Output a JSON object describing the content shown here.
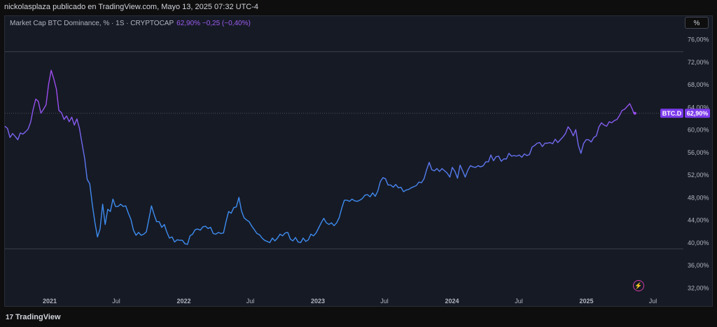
{
  "header": {
    "publisher_line": "nickolasplaza publicado en TradingView.com, Mayo 13, 2025 07:32 UTC-4"
  },
  "legend": {
    "symbol_text": "Market Cap BTC Dominance, % · 1S · CRYPTOCAP",
    "value_text": "62,90%  −0,25 (−0,40%)"
  },
  "controls": {
    "percent_button": "%",
    "bolt_icon": "⚡"
  },
  "footer": {
    "brand": "TradingView",
    "logo_icon": "17"
  },
  "colors": {
    "line_start": "#3d8cf0",
    "line_end": "#9d4cf0",
    "tag_bg": "#7c3aed",
    "accent": "#9d5cf0"
  },
  "chart_data": {
    "type": "line",
    "title": "Market Cap BTC Dominance, % · 1S · CRYPTOCAP",
    "ylim": [
      30,
      78
    ],
    "xlim": [
      "2020-09-01",
      "2025-09-20"
    ],
    "y_ticks": [
      32,
      36,
      40,
      44,
      48,
      52,
      56,
      60,
      64,
      68,
      72,
      76
    ],
    "y_tick_labels": [
      "32,00%",
      "36,00%",
      "40,00%",
      "44,00%",
      "48,00%",
      "52,00%",
      "56,00%",
      "60,00%",
      "64,00%",
      "68,00%",
      "72,00%",
      "76,00%"
    ],
    "x_ticks": [
      {
        "date": "2021-01-01",
        "label": "2021"
      },
      {
        "date": "2021-07-01",
        "label": "Jul"
      },
      {
        "date": "2022-01-01",
        "label": "2022"
      },
      {
        "date": "2022-07-01",
        "label": "Jul"
      },
      {
        "date": "2023-01-01",
        "label": "2023"
      },
      {
        "date": "2023-07-01",
        "label": "Jul"
      },
      {
        "date": "2024-01-01",
        "label": "2024"
      },
      {
        "date": "2024-07-01",
        "label": "Jul"
      },
      {
        "date": "2025-01-01",
        "label": "2025"
      },
      {
        "date": "2025-07-01",
        "label": "Jul"
      }
    ],
    "hlines": [
      73.8,
      38.9
    ],
    "current_value": 62.9,
    "current_tag": {
      "symbol": "BTC.D",
      "value": "62,90%"
    },
    "series": [
      {
        "points": [
          [
            "2020-09-01",
            60.6
          ],
          [
            "2020-09-08",
            60.2
          ],
          [
            "2020-09-15",
            58.6
          ],
          [
            "2020-09-22",
            59.3
          ],
          [
            "2020-09-29",
            58.8
          ],
          [
            "2020-10-06",
            58.2
          ],
          [
            "2020-10-13",
            59.4
          ],
          [
            "2020-10-20",
            59.2
          ],
          [
            "2020-10-27",
            59.6
          ],
          [
            "2020-11-03",
            60.1
          ],
          [
            "2020-11-10",
            61.3
          ],
          [
            "2020-11-17",
            63.6
          ],
          [
            "2020-11-24",
            65.4
          ],
          [
            "2020-12-01",
            65.0
          ],
          [
            "2020-12-08",
            62.9
          ],
          [
            "2020-12-15",
            63.6
          ],
          [
            "2020-12-22",
            64.4
          ],
          [
            "2020-12-29",
            68.0
          ],
          [
            "2021-01-05",
            70.5
          ],
          [
            "2021-01-12",
            69.0
          ],
          [
            "2021-01-19",
            67.2
          ],
          [
            "2021-01-26",
            63.4
          ],
          [
            "2021-02-02",
            63.0
          ],
          [
            "2021-02-09",
            61.8
          ],
          [
            "2021-02-16",
            62.4
          ],
          [
            "2021-02-23",
            61.4
          ],
          [
            "2021-03-02",
            62.2
          ],
          [
            "2021-03-09",
            60.8
          ],
          [
            "2021-03-16",
            61.9
          ],
          [
            "2021-03-23",
            60.2
          ],
          [
            "2021-03-30",
            57.5
          ],
          [
            "2021-04-06",
            54.9
          ],
          [
            "2021-04-13",
            51.2
          ],
          [
            "2021-04-20",
            50.4
          ],
          [
            "2021-04-27",
            46.7
          ],
          [
            "2021-05-04",
            43.6
          ],
          [
            "2021-05-11",
            41.0
          ],
          [
            "2021-05-18",
            42.4
          ],
          [
            "2021-05-25",
            46.8
          ],
          [
            "2021-06-01",
            43.2
          ],
          [
            "2021-06-08",
            45.9
          ],
          [
            "2021-06-15",
            45.5
          ],
          [
            "2021-06-22",
            47.7
          ],
          [
            "2021-06-29",
            46.4
          ],
          [
            "2021-07-06",
            46.4
          ],
          [
            "2021-07-13",
            46.8
          ],
          [
            "2021-07-20",
            46.4
          ],
          [
            "2021-07-27",
            46.5
          ],
          [
            "2021-08-03",
            45.2
          ],
          [
            "2021-08-10",
            44.1
          ],
          [
            "2021-08-17",
            42.2
          ],
          [
            "2021-08-24",
            41.3
          ],
          [
            "2021-08-31",
            41.8
          ],
          [
            "2021-09-07",
            41.3
          ],
          [
            "2021-09-14",
            41.5
          ],
          [
            "2021-09-21",
            41.9
          ],
          [
            "2021-09-28",
            44.2
          ],
          [
            "2021-10-05",
            46.5
          ],
          [
            "2021-10-12",
            45.0
          ],
          [
            "2021-10-19",
            43.7
          ],
          [
            "2021-10-26",
            43.7
          ],
          [
            "2021-11-02",
            42.7
          ],
          [
            "2021-11-09",
            43.2
          ],
          [
            "2021-11-16",
            41.8
          ],
          [
            "2021-11-23",
            40.8
          ],
          [
            "2021-11-30",
            41.0
          ],
          [
            "2021-12-07",
            40.1
          ],
          [
            "2021-12-14",
            40.5
          ],
          [
            "2021-12-21",
            40.4
          ],
          [
            "2021-12-28",
            40.4
          ],
          [
            "2022-01-04",
            39.8
          ],
          [
            "2022-01-11",
            39.7
          ],
          [
            "2022-01-18",
            41.2
          ],
          [
            "2022-01-25",
            41.5
          ],
          [
            "2022-02-01",
            42.3
          ],
          [
            "2022-02-08",
            42.4
          ],
          [
            "2022-02-15",
            42.2
          ],
          [
            "2022-02-22",
            42.8
          ],
          [
            "2022-03-01",
            42.9
          ],
          [
            "2022-03-08",
            42.5
          ],
          [
            "2022-03-15",
            42.7
          ],
          [
            "2022-03-22",
            41.6
          ],
          [
            "2022-03-29",
            41.5
          ],
          [
            "2022-04-05",
            41.8
          ],
          [
            "2022-04-12",
            41.6
          ],
          [
            "2022-04-19",
            41.7
          ],
          [
            "2022-04-26",
            43.7
          ],
          [
            "2022-05-03",
            45.5
          ],
          [
            "2022-05-10",
            45.2
          ],
          [
            "2022-05-17",
            46.2
          ],
          [
            "2022-05-24",
            46.3
          ],
          [
            "2022-05-31",
            48.0
          ],
          [
            "2022-06-07",
            45.6
          ],
          [
            "2022-06-14",
            44.4
          ],
          [
            "2022-06-21",
            44.0
          ],
          [
            "2022-06-28",
            43.7
          ],
          [
            "2022-07-05",
            42.9
          ],
          [
            "2022-07-12",
            42.3
          ],
          [
            "2022-07-19",
            41.6
          ],
          [
            "2022-07-26",
            41.4
          ],
          [
            "2022-08-02",
            40.8
          ],
          [
            "2022-08-09",
            40.4
          ],
          [
            "2022-08-16",
            40.2
          ],
          [
            "2022-08-23",
            40.0
          ],
          [
            "2022-08-30",
            40.8
          ],
          [
            "2022-09-06",
            40.3
          ],
          [
            "2022-09-13",
            40.8
          ],
          [
            "2022-09-20",
            41.5
          ],
          [
            "2022-09-27",
            41.2
          ],
          [
            "2022-10-04",
            41.7
          ],
          [
            "2022-10-11",
            41.8
          ],
          [
            "2022-10-18",
            40.6
          ],
          [
            "2022-10-25",
            40.3
          ],
          [
            "2022-11-01",
            40.9
          ],
          [
            "2022-11-08",
            40.1
          ],
          [
            "2022-11-15",
            40.0
          ],
          [
            "2022-11-22",
            40.8
          ],
          [
            "2022-11-29",
            40.2
          ],
          [
            "2022-12-06",
            40.5
          ],
          [
            "2022-12-13",
            41.5
          ],
          [
            "2022-12-20",
            41.2
          ],
          [
            "2022-12-27",
            41.7
          ],
          [
            "2023-01-03",
            42.6
          ],
          [
            "2023-01-10",
            43.5
          ],
          [
            "2023-01-17",
            44.3
          ],
          [
            "2023-01-24",
            43.5
          ],
          [
            "2023-01-31",
            43.2
          ],
          [
            "2023-02-07",
            43.5
          ],
          [
            "2023-02-14",
            43.0
          ],
          [
            "2023-02-21",
            43.5
          ],
          [
            "2023-02-28",
            44.4
          ],
          [
            "2023-03-07",
            46.1
          ],
          [
            "2023-03-14",
            47.5
          ],
          [
            "2023-03-21",
            47.5
          ],
          [
            "2023-03-28",
            47.3
          ],
          [
            "2023-04-04",
            47.7
          ],
          [
            "2023-04-11",
            47.4
          ],
          [
            "2023-04-18",
            47.3
          ],
          [
            "2023-04-25",
            47.5
          ],
          [
            "2023-05-02",
            47.8
          ],
          [
            "2023-05-09",
            48.4
          ],
          [
            "2023-05-16",
            48.5
          ],
          [
            "2023-05-23",
            48.1
          ],
          [
            "2023-05-30",
            48.8
          ],
          [
            "2023-06-06",
            48.2
          ],
          [
            "2023-06-13",
            49.1
          ],
          [
            "2023-06-20",
            50.8
          ],
          [
            "2023-06-27",
            51.5
          ],
          [
            "2023-07-04",
            51.3
          ],
          [
            "2023-07-11",
            50.2
          ],
          [
            "2023-07-18",
            50.2
          ],
          [
            "2023-07-25",
            49.8
          ],
          [
            "2023-08-01",
            50.3
          ],
          [
            "2023-08-08",
            49.7
          ],
          [
            "2023-08-15",
            49.8
          ],
          [
            "2023-08-22",
            49.0
          ],
          [
            "2023-08-29",
            49.3
          ],
          [
            "2023-09-05",
            49.4
          ],
          [
            "2023-09-12",
            49.7
          ],
          [
            "2023-09-19",
            49.9
          ],
          [
            "2023-09-26",
            50.1
          ],
          [
            "2023-10-03",
            50.7
          ],
          [
            "2023-10-10",
            50.6
          ],
          [
            "2023-10-17",
            51.3
          ],
          [
            "2023-10-24",
            52.9
          ],
          [
            "2023-10-31",
            54.2
          ],
          [
            "2023-11-07",
            52.9
          ],
          [
            "2023-11-14",
            52.7
          ],
          [
            "2023-11-21",
            53.1
          ],
          [
            "2023-11-28",
            52.6
          ],
          [
            "2023-12-05",
            53.1
          ],
          [
            "2023-12-12",
            52.7
          ],
          [
            "2023-12-19",
            52.3
          ],
          [
            "2023-12-26",
            51.6
          ],
          [
            "2024-01-02",
            53.3
          ],
          [
            "2024-01-09",
            52.6
          ],
          [
            "2024-01-16",
            51.4
          ],
          [
            "2024-01-23",
            53.7
          ],
          [
            "2024-01-30",
            52.7
          ],
          [
            "2024-02-06",
            51.6
          ],
          [
            "2024-02-13",
            52.8
          ],
          [
            "2024-02-20",
            53.6
          ],
          [
            "2024-02-27",
            53.4
          ],
          [
            "2024-03-05",
            53.3
          ],
          [
            "2024-03-12",
            53.6
          ],
          [
            "2024-03-19",
            53.4
          ],
          [
            "2024-03-26",
            53.6
          ],
          [
            "2024-04-02",
            54.3
          ],
          [
            "2024-04-09",
            54.3
          ],
          [
            "2024-04-16",
            55.5
          ],
          [
            "2024-04-23",
            54.5
          ],
          [
            "2024-04-30",
            55.2
          ],
          [
            "2024-05-07",
            55.3
          ],
          [
            "2024-05-14",
            54.4
          ],
          [
            "2024-05-21",
            54.8
          ],
          [
            "2024-05-28",
            54.8
          ],
          [
            "2024-06-04",
            55.8
          ],
          [
            "2024-06-11",
            55.3
          ],
          [
            "2024-06-18",
            55.4
          ],
          [
            "2024-06-25",
            55.3
          ],
          [
            "2024-07-02",
            55.5
          ],
          [
            "2024-07-09",
            55.1
          ],
          [
            "2024-07-16",
            55.7
          ],
          [
            "2024-07-23",
            55.4
          ],
          [
            "2024-07-30",
            55.6
          ],
          [
            "2024-08-06",
            56.9
          ],
          [
            "2024-08-13",
            57.2
          ],
          [
            "2024-08-20",
            57.6
          ],
          [
            "2024-08-27",
            57.7
          ],
          [
            "2024-09-03",
            57.0
          ],
          [
            "2024-09-10",
            57.6
          ],
          [
            "2024-09-17",
            57.6
          ],
          [
            "2024-09-24",
            57.7
          ],
          [
            "2024-10-01",
            57.5
          ],
          [
            "2024-10-08",
            58.3
          ],
          [
            "2024-10-15",
            57.7
          ],
          [
            "2024-10-22",
            58.2
          ],
          [
            "2024-10-29",
            58.7
          ],
          [
            "2024-11-05",
            59.3
          ],
          [
            "2024-11-12",
            60.5
          ],
          [
            "2024-11-19",
            59.9
          ],
          [
            "2024-11-26",
            58.9
          ],
          [
            "2024-12-03",
            60.0
          ],
          [
            "2024-12-10",
            57.2
          ],
          [
            "2024-12-17",
            55.8
          ],
          [
            "2024-12-24",
            57.5
          ],
          [
            "2024-12-31",
            58.2
          ],
          [
            "2025-01-07",
            58.2
          ],
          [
            "2025-01-14",
            57.8
          ],
          [
            "2025-01-21",
            58.6
          ],
          [
            "2025-01-28",
            58.9
          ],
          [
            "2025-02-04",
            60.5
          ],
          [
            "2025-02-11",
            61.2
          ],
          [
            "2025-02-18",
            60.8
          ],
          [
            "2025-02-25",
            60.6
          ],
          [
            "2025-03-04",
            61.4
          ],
          [
            "2025-03-11",
            61.2
          ],
          [
            "2025-03-18",
            61.6
          ],
          [
            "2025-03-25",
            61.8
          ],
          [
            "2025-04-01",
            62.5
          ],
          [
            "2025-04-08",
            63.4
          ],
          [
            "2025-04-15",
            63.6
          ],
          [
            "2025-04-22",
            64.1
          ],
          [
            "2025-04-29",
            64.6
          ],
          [
            "2025-05-06",
            63.6
          ],
          [
            "2025-05-10",
            62.9
          ],
          [
            "2025-05-13",
            62.9
          ]
        ]
      }
    ]
  }
}
